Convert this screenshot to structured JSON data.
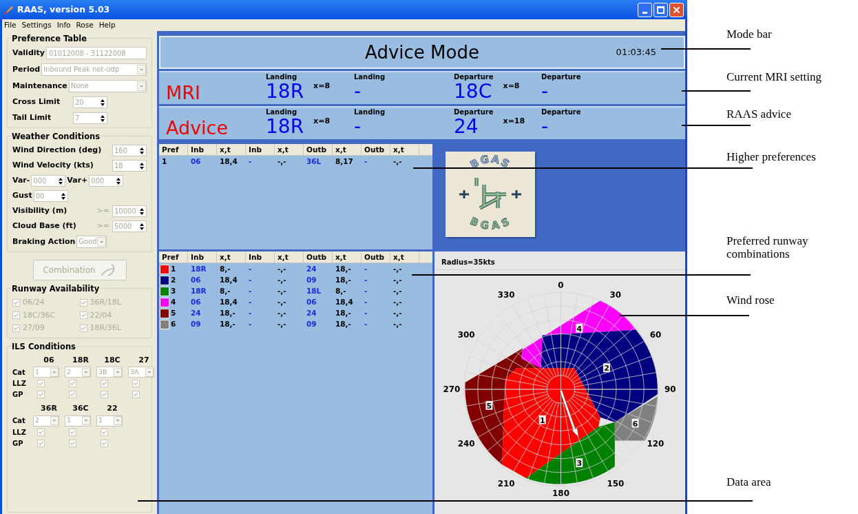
{
  "window": {
    "title": "RAAS, version 5.03"
  },
  "menu": [
    "File",
    "Settings",
    "Info",
    "Rose",
    "Help"
  ],
  "preference_table": {
    "title": "Preference Table",
    "fields": [
      {
        "label": "Validity",
        "value": "01012008 - 31122008",
        "kind": "text",
        "disabled": true
      },
      {
        "label": "Period",
        "value": "Inbound Peak not-udp",
        "kind": "dropdown",
        "disabled": true
      },
      {
        "label": "Maintenance",
        "value": "None",
        "kind": "dropdown",
        "disabled": true
      },
      {
        "label": "Cross Limit",
        "value": "20",
        "kind": "spinner",
        "disabled": true
      },
      {
        "label": "Tail Limit",
        "value": "7",
        "kind": "spinner",
        "disabled": true
      }
    ]
  },
  "weather_conditions": {
    "title": "Weather Conditions",
    "rows": [
      [
        {
          "label": "Wind Direction (deg)",
          "value": "160",
          "kind": "spinner",
          "disabled": true
        }
      ],
      [
        {
          "label": "Wind Velocity (kts)",
          "value": "18",
          "kind": "spinner",
          "disabled": true
        }
      ],
      [
        {
          "label": "Var-",
          "value": "000",
          "kind": "spinner",
          "disabled": true
        },
        {
          "label": "Var+",
          "value": "000",
          "kind": "spinner",
          "disabled": true
        }
      ],
      [
        {
          "label": "Gust",
          "value": "00",
          "kind": "spinner",
          "disabled": true
        }
      ],
      [
        {
          "label": "Visibility (m)",
          "prefix": ">=",
          "value": "10000",
          "kind": "spinner",
          "disabled": true
        }
      ],
      [
        {
          "label": "Cloud Base (ft)",
          "prefix": ">=",
          "value": "5000",
          "kind": "spinner",
          "disabled": true
        }
      ],
      [
        {
          "label": "Braking Action",
          "value": "Good",
          "kind": "dropdown",
          "disabled": true
        }
      ]
    ]
  },
  "combination_button": {
    "label": "Combination",
    "disabled": true
  },
  "runway_availability": {
    "title": "Runway Availability",
    "items": [
      {
        "label": "06/24",
        "checked": true,
        "disabled": true
      },
      {
        "label": "36R/18L",
        "checked": true,
        "disabled": true
      },
      {
        "label": "18C/36C",
        "checked": true,
        "disabled": true
      },
      {
        "label": "22/04",
        "checked": true,
        "disabled": true
      },
      {
        "label": "27/09",
        "checked": true,
        "disabled": true
      },
      {
        "label": "18R/36L",
        "checked": true,
        "disabled": true
      }
    ]
  },
  "ils_conditions": {
    "title": "ILS Conditions",
    "groups": [
      {
        "row_labels": [
          "Cat",
          "LLZ",
          "GP"
        ],
        "runways": [
          {
            "name": "06",
            "cat": "1",
            "llz": true,
            "gp": true
          },
          {
            "name": "18R",
            "cat": "2",
            "llz": true,
            "gp": true
          },
          {
            "name": "18C",
            "cat": "3B",
            "llz": true,
            "gp": true
          },
          {
            "name": "27",
            "cat": "3A",
            "llz": true,
            "gp": true
          }
        ]
      },
      {
        "row_labels": [
          "Cat",
          "LLZ",
          "GP"
        ],
        "runways": [
          {
            "name": "36R",
            "cat": "2",
            "llz": true,
            "gp": true
          },
          {
            "name": "36C",
            "cat": "1",
            "llz": true,
            "gp": true
          },
          {
            "name": "22",
            "cat": "1",
            "llz": true,
            "gp": true
          }
        ]
      }
    ]
  },
  "mode_bar": {
    "title": "Advice Mode",
    "time": "01:03:45"
  },
  "settings": [
    {
      "label": "MRI",
      "columns": [
        {
          "header": "Landing",
          "value": "18R",
          "x": "x=8"
        },
        {
          "header": "Landing",
          "value": "-"
        },
        {
          "header": "Departure",
          "value": "18C",
          "x": "x=8"
        },
        {
          "header": "Departure",
          "value": "-"
        }
      ]
    },
    {
      "label": "Advice",
      "columns": [
        {
          "header": "Landing",
          "value": "18R",
          "x": "x=8"
        },
        {
          "header": "Landing",
          "value": "-"
        },
        {
          "header": "Departure",
          "value": "24",
          "x": "x=18"
        },
        {
          "header": "Departure",
          "value": "-"
        }
      ]
    }
  ],
  "higher_preferences": {
    "columns": [
      "Pref",
      "Inb",
      "x,t",
      "Inb",
      "x,t",
      "Outb",
      "x,t",
      "Outb",
      "x,t"
    ],
    "rows": [
      {
        "cells": [
          "1",
          "06",
          "18,4",
          "-",
          "-,-",
          "36L",
          "8,17",
          "-",
          "-,-"
        ]
      }
    ]
  },
  "preferred_combinations": {
    "columns": [
      "Pref",
      "Inb",
      "x,t",
      "Inb",
      "x,t",
      "Outb",
      "x,t",
      "Outb",
      "x,t"
    ],
    "rows": [
      {
        "color": "#ff0000",
        "cells": [
          "1",
          "18R",
          "8,-",
          "-",
          "-,-",
          "24",
          "18,-",
          "-",
          "-,-"
        ]
      },
      {
        "color": "#000080",
        "cells": [
          "2",
          "06",
          "18,4",
          "-",
          "-,-",
          "09",
          "18,-",
          "-",
          "-,-"
        ]
      },
      {
        "color": "#008000",
        "cells": [
          "3",
          "18R",
          "8,-",
          "-",
          "-,-",
          "18L",
          "8,-",
          "-",
          "-,-"
        ]
      },
      {
        "color": "#ff00ff",
        "cells": [
          "4",
          "06",
          "18,4",
          "-",
          "-,-",
          "06",
          "18,4",
          "-",
          "-,-"
        ]
      },
      {
        "color": "#800000",
        "cells": [
          "5",
          "24",
          "18,-",
          "-",
          "-,-",
          "24",
          "18,-",
          "-",
          "-,-"
        ]
      },
      {
        "color": "#808080",
        "cells": [
          "6",
          "09",
          "18,-",
          "-",
          "-,-",
          "09",
          "18,-",
          "-",
          "-,-"
        ]
      }
    ]
  },
  "logo": {
    "top": "BGAS",
    "bottom": "BGAS"
  },
  "wind_rose": {
    "radius_label": "Radius=35kts",
    "angle_labels": [
      "0",
      "30",
      "60",
      "90",
      "120",
      "150",
      "180",
      "210",
      "240",
      "270",
      "300",
      "330"
    ],
    "regions": [
      {
        "label": "1",
        "color": "#ff0000"
      },
      {
        "label": "2",
        "color": "#000080"
      },
      {
        "label": "3",
        "color": "#008000"
      },
      {
        "label": "4",
        "color": "#ff00ff"
      },
      {
        "label": "5",
        "color": "#800000"
      },
      {
        "label": "6",
        "color": "#808080"
      }
    ]
  },
  "annotations": [
    "Mode bar",
    "Current MRI setting",
    "RAAS advice",
    "Higher preferences",
    "Preferred runway combinations",
    "Wind rose",
    "Data area"
  ]
}
